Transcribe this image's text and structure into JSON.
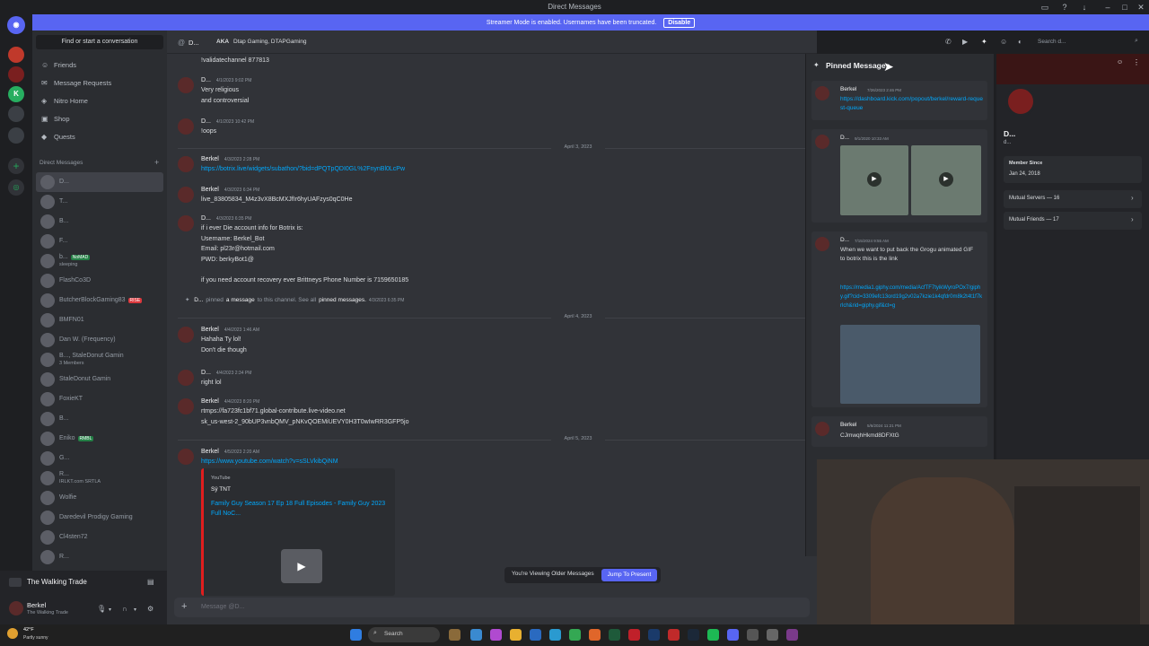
{
  "window": {
    "title": "Direct Messages"
  },
  "streamer_banner": {
    "text": "Streamer Mode is enabled. Usernames have been truncated.",
    "button": "Disable"
  },
  "sidebar": {
    "find_button": "Find or start a conversation",
    "nav": [
      {
        "label": "Friends",
        "icon": "friends-icon"
      },
      {
        "label": "Message Requests",
        "icon": "envelope-icon"
      },
      {
        "label": "Nitro Home",
        "icon": "nitro-icon"
      },
      {
        "label": "Shop",
        "icon": "shop-icon"
      },
      {
        "label": "Quests",
        "icon": "quests-icon"
      }
    ],
    "dm_header": "Direct Messages",
    "dms": [
      {
        "name": "D...",
        "sub": "",
        "badge": ""
      },
      {
        "name": "T...",
        "sub": "",
        "badge": ""
      },
      {
        "name": "B...",
        "sub": "",
        "badge": ""
      },
      {
        "name": "F...",
        "sub": "",
        "badge": ""
      },
      {
        "name": "b...",
        "sub": "sleeping",
        "badge": "NoMAD"
      },
      {
        "name": "FlashCo3D",
        "sub": "",
        "badge": ""
      },
      {
        "name": "ButcherBlockGaming83",
        "sub": "",
        "badge": "RISE"
      },
      {
        "name": "BMFN01",
        "sub": "",
        "badge": ""
      },
      {
        "name": "Dan W. (Frequency)",
        "sub": "",
        "badge": ""
      },
      {
        "name": "B..., StaleDonut Gamin",
        "sub": "3 Members",
        "badge": ""
      },
      {
        "name": "StaleDonut Gamin",
        "sub": "",
        "badge": ""
      },
      {
        "name": "FoxieKT",
        "sub": "",
        "badge": ""
      },
      {
        "name": "B...",
        "sub": "",
        "badge": ""
      },
      {
        "name": "Eniko",
        "sub": "",
        "badge": "RMBL"
      },
      {
        "name": "G...",
        "sub": "",
        "badge": ""
      },
      {
        "name": "R...",
        "sub": "IRLKT.com SRTLA",
        "badge": ""
      },
      {
        "name": "Wolfie",
        "sub": "",
        "badge": ""
      },
      {
        "name": "Daredevil Prodigy Gaming",
        "sub": "",
        "badge": ""
      },
      {
        "name": "Cl4sten72",
        "sub": "",
        "badge": ""
      },
      {
        "name": "R...",
        "sub": "",
        "badge": ""
      }
    ]
  },
  "user_panel": {
    "activity": "The Walking Trade",
    "name": "Berkel",
    "status": "The Walking Trade"
  },
  "chat": {
    "header": {
      "name": "D...",
      "aka_label": "AKA",
      "aka": "Dtap Gaming, DTAPGaming",
      "search_placeholder": "Search d..."
    },
    "messages": [
      {
        "author": "",
        "time": "",
        "lines": [
          "!validatechannel 877813"
        ]
      },
      {
        "author": "D...",
        "time": "4/1/2023 9:02 PM",
        "lines": [
          "Very religious",
          "and controversial"
        ]
      },
      {
        "author": "D...",
        "time": "4/1/2023 10:42 PM",
        "lines": [
          "!oops"
        ]
      },
      {
        "author": "Berkel",
        "time": "4/3/2023 2:28 PM",
        "lines": [
          "https://botrix.live/widgets/subathon/?bid=dPQTpQDI0GL%2FnynBl0LcPw"
        ],
        "link": true
      },
      {
        "author": "Berkel",
        "time": "4/3/2023 6:34 PM",
        "lines": [
          "live_83805834_M4z3vX8BcMXJfIr6hyUAFzys0qC0He"
        ]
      },
      {
        "author": "D...",
        "time": "4/3/2023 6:35 PM",
        "lines": [
          "if i ever Die account info for Botrix is:",
          "Username: Berkel_Bot",
          "Email: pl23r@hotmail.com",
          "PWD: berkyBot1@",
          "",
          "if you need account recovery ever Brittneys Phone Number is 7159650185"
        ]
      },
      {
        "author": "Berkel",
        "time": "4/4/2023 1:46 AM",
        "lines": [
          "Hahaha Ty lol!",
          "Don't die though"
        ]
      },
      {
        "author": "D...",
        "time": "4/4/2023 2:34 PM",
        "lines": [
          "right lol"
        ]
      },
      {
        "author": "Berkel",
        "time": "4/4/2023 8:20 PM",
        "lines": [
          "rtmps://fa723fc1bf71.global-contribute.live-video.net",
          "sk_us-west-2_90bUP3vnbQMV_pNKvQOEMiUEVY0H3T0wIwRR3GFP5jo"
        ]
      },
      {
        "author": "Berkel",
        "time": "4/5/2023 2:20 AM",
        "lines": [
          "https://www.youtube.com/watch?v=sSLVkibQiNM"
        ],
        "link": true
      }
    ],
    "system_pin": {
      "actor": "D...",
      "pre": "pinned",
      "link": "a message",
      "mid": "to this channel. See all",
      "link2": "pinned messages.",
      "time": "4/3/2023 6:35 PM"
    },
    "dividers": [
      "April 3, 2023",
      "April 4, 2023",
      "April 5, 2023"
    ],
    "embed": {
      "provider": "YouTube",
      "channel": "Sÿ TNT",
      "title": "Family Guy Season 17 Ep 18 Full Episodes - Family Guy 2023 Full NoC..."
    },
    "older_text": "You're Viewing Older Messages",
    "jump_button": "Jump To Present",
    "composer_placeholder": "Message @D..."
  },
  "pins": {
    "title": "Pinned Messages",
    "items": [
      {
        "author": "Berkel",
        "time": "7/26/2023 2:46 PM",
        "text": "https://dashboard.kick.com/popout/berkel/reward-request-queue"
      },
      {
        "author": "D...",
        "time": "9/1/2020 10:33 AM",
        "text": ""
      },
      {
        "author": "D...",
        "time": "7/15/2024 9:55 AM",
        "text": "When we want to put back the Grogu animated GIF to botrix this is the link",
        "link": "https://media1.giphy.com/media/AcfTF7tyikWyroPOx7/giphy.gif?cid=3309efc13ord19g2v02a7kzie1k4qfdr0m8k2t4t1f7krlch&rid=giphy.gif&ct=g"
      },
      {
        "author": "Berkel",
        "time": "5/6/2024 11:21 PM",
        "text": "CJmwqhHkmd8DFXtG"
      }
    ]
  },
  "profile": {
    "name": "D...",
    "handle": "d...",
    "member_since_label": "Member Since",
    "member_since": "Jan 24, 2018",
    "mutual_servers": "Mutual Servers — 16",
    "mutual_friends": "Mutual Friends — 17"
  },
  "taskbar": {
    "weather_temp": "42°F",
    "weather_desc": "Partly sunny",
    "search": "Search"
  },
  "colors": {
    "blurple": "#5865f2",
    "link": "#00a8fc",
    "bg": "#313338"
  }
}
